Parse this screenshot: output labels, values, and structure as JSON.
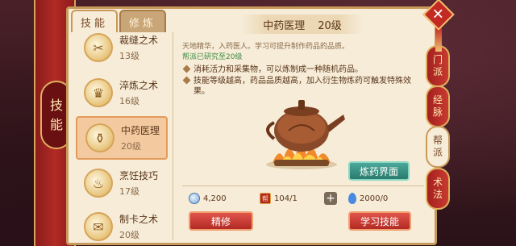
{
  "side": {
    "label_1": "技",
    "label_2": "能"
  },
  "tabs": [
    {
      "label": "技能",
      "active": true
    },
    {
      "label": "修炼",
      "active": false
    }
  ],
  "skills": [
    {
      "name": "裁缝之术",
      "level": "13级",
      "icon": "needle-thread-icon"
    },
    {
      "name": "淬炼之术",
      "level": "16级",
      "icon": "golden-cup-icon"
    },
    {
      "name": "中药医理",
      "level": "20级",
      "icon": "medicine-jar-icon",
      "selected": true
    },
    {
      "name": "烹饪技巧",
      "level": "17级",
      "icon": "cooking-dish-icon"
    },
    {
      "name": "制卡之术",
      "level": "20级",
      "icon": "card-envelope-icon"
    }
  ],
  "detail": {
    "name": "中药医理",
    "level": "20级",
    "description": "天地精华，入药医人。学习可提升制作药品的品质。",
    "research": "帮派已研究至20级",
    "bullet_1": "消耗活力和采集物，可以炼制成一种随机药品。",
    "bullet_2": "技能等级越高，药品品质越高，加入衍生物炼药可触发特殊效果。"
  },
  "stats": {
    "silver": "4,200",
    "contribution": "104/1",
    "contribution_badge": "帮",
    "vitality": "2000/0"
  },
  "buttons": {
    "craft": "炼药界面",
    "refine": "精修",
    "learn": "学习技能",
    "close": "✕"
  },
  "right_tabs": [
    {
      "l1": "门",
      "l2": "派",
      "active": false
    },
    {
      "l1": "经",
      "l2": "脉",
      "active": false
    },
    {
      "l1": "帮",
      "l2": "派",
      "active": true
    },
    {
      "l1": "术",
      "l2": "法",
      "active": false
    }
  ],
  "colors": {
    "accent_red": "#b22a24",
    "parchment": "#f6ecd8",
    "teal": "#2a7a6c"
  }
}
